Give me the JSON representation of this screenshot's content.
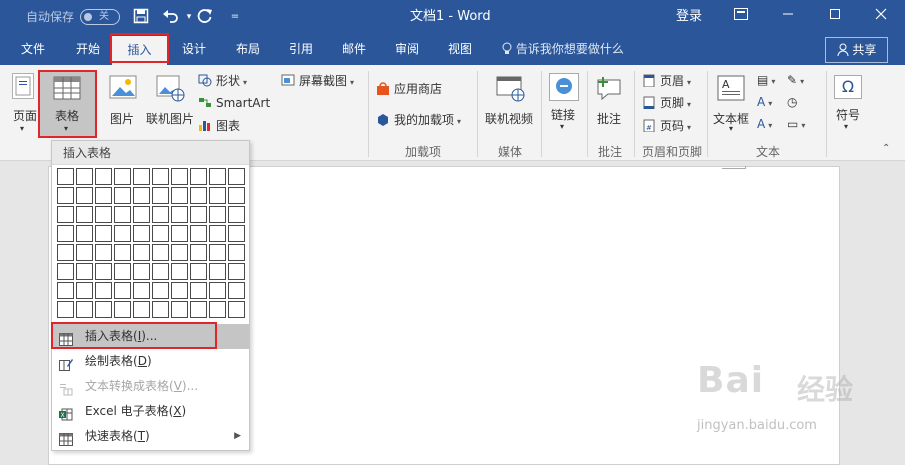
{
  "titlebar": {
    "autosave_label": "自动保存",
    "autosave_state": "关",
    "document_title": "文档1 - Word",
    "login_label": "登录"
  },
  "tabs": [
    {
      "label": "文件"
    },
    {
      "label": "开始"
    },
    {
      "label": "插入",
      "active": true
    },
    {
      "label": "设计"
    },
    {
      "label": "布局"
    },
    {
      "label": "引用"
    },
    {
      "label": "邮件"
    },
    {
      "label": "审阅"
    },
    {
      "label": "视图"
    }
  ],
  "tell_me": "告诉我你想要做什么",
  "share_label": "共享",
  "ribbon": {
    "page_label": "页面",
    "table_label": "表格",
    "picture_label": "图片",
    "online_picture_label": "联机图片",
    "shapes_label": "形状",
    "smartart_label": "SmartArt",
    "chart_label": "图表",
    "screenshot_label": "屏幕截图",
    "store_label": "应用商店",
    "my_addins_label": "我的加载项",
    "addins_group": "加载项",
    "online_video_label": "联机视频",
    "media_group": "媒体",
    "link_label": "链接",
    "comment_label": "批注",
    "comment_group": "批注",
    "header_label": "页眉",
    "footer_label": "页脚",
    "page_number_label": "页码",
    "header_footer_group": "页眉和页脚",
    "textbox_label": "文本框",
    "text_group": "文本",
    "symbol_label": "符号"
  },
  "dropdown": {
    "header": "插入表格",
    "grid_cols": 10,
    "grid_rows": 8,
    "items": [
      {
        "label": "插入表格(",
        "key": "I",
        "suffix": ")...",
        "icon": "insert-table-icon"
      },
      {
        "label": "绘制表格(",
        "key": "D",
        "suffix": ")",
        "icon": "draw-table-icon"
      },
      {
        "label": "文本转换成表格(",
        "key": "V",
        "suffix": ")...",
        "icon": "convert-text-icon",
        "disabled": true
      },
      {
        "label": "Excel 电子表格(",
        "key": "X",
        "suffix": ")",
        "icon": "excel-sheet-icon"
      },
      {
        "label": "快速表格(",
        "key": "T",
        "suffix": ")",
        "icon": "quick-table-icon",
        "submenu": true
      }
    ]
  },
  "watermark": {
    "logo": "Bai",
    "brand": "经验",
    "url": "jingyan.baidu.com"
  },
  "colors": {
    "title_bar": "#2b579a",
    "ribbon_bg": "#f3f3f3",
    "highlight_outline": "#e0252b"
  }
}
